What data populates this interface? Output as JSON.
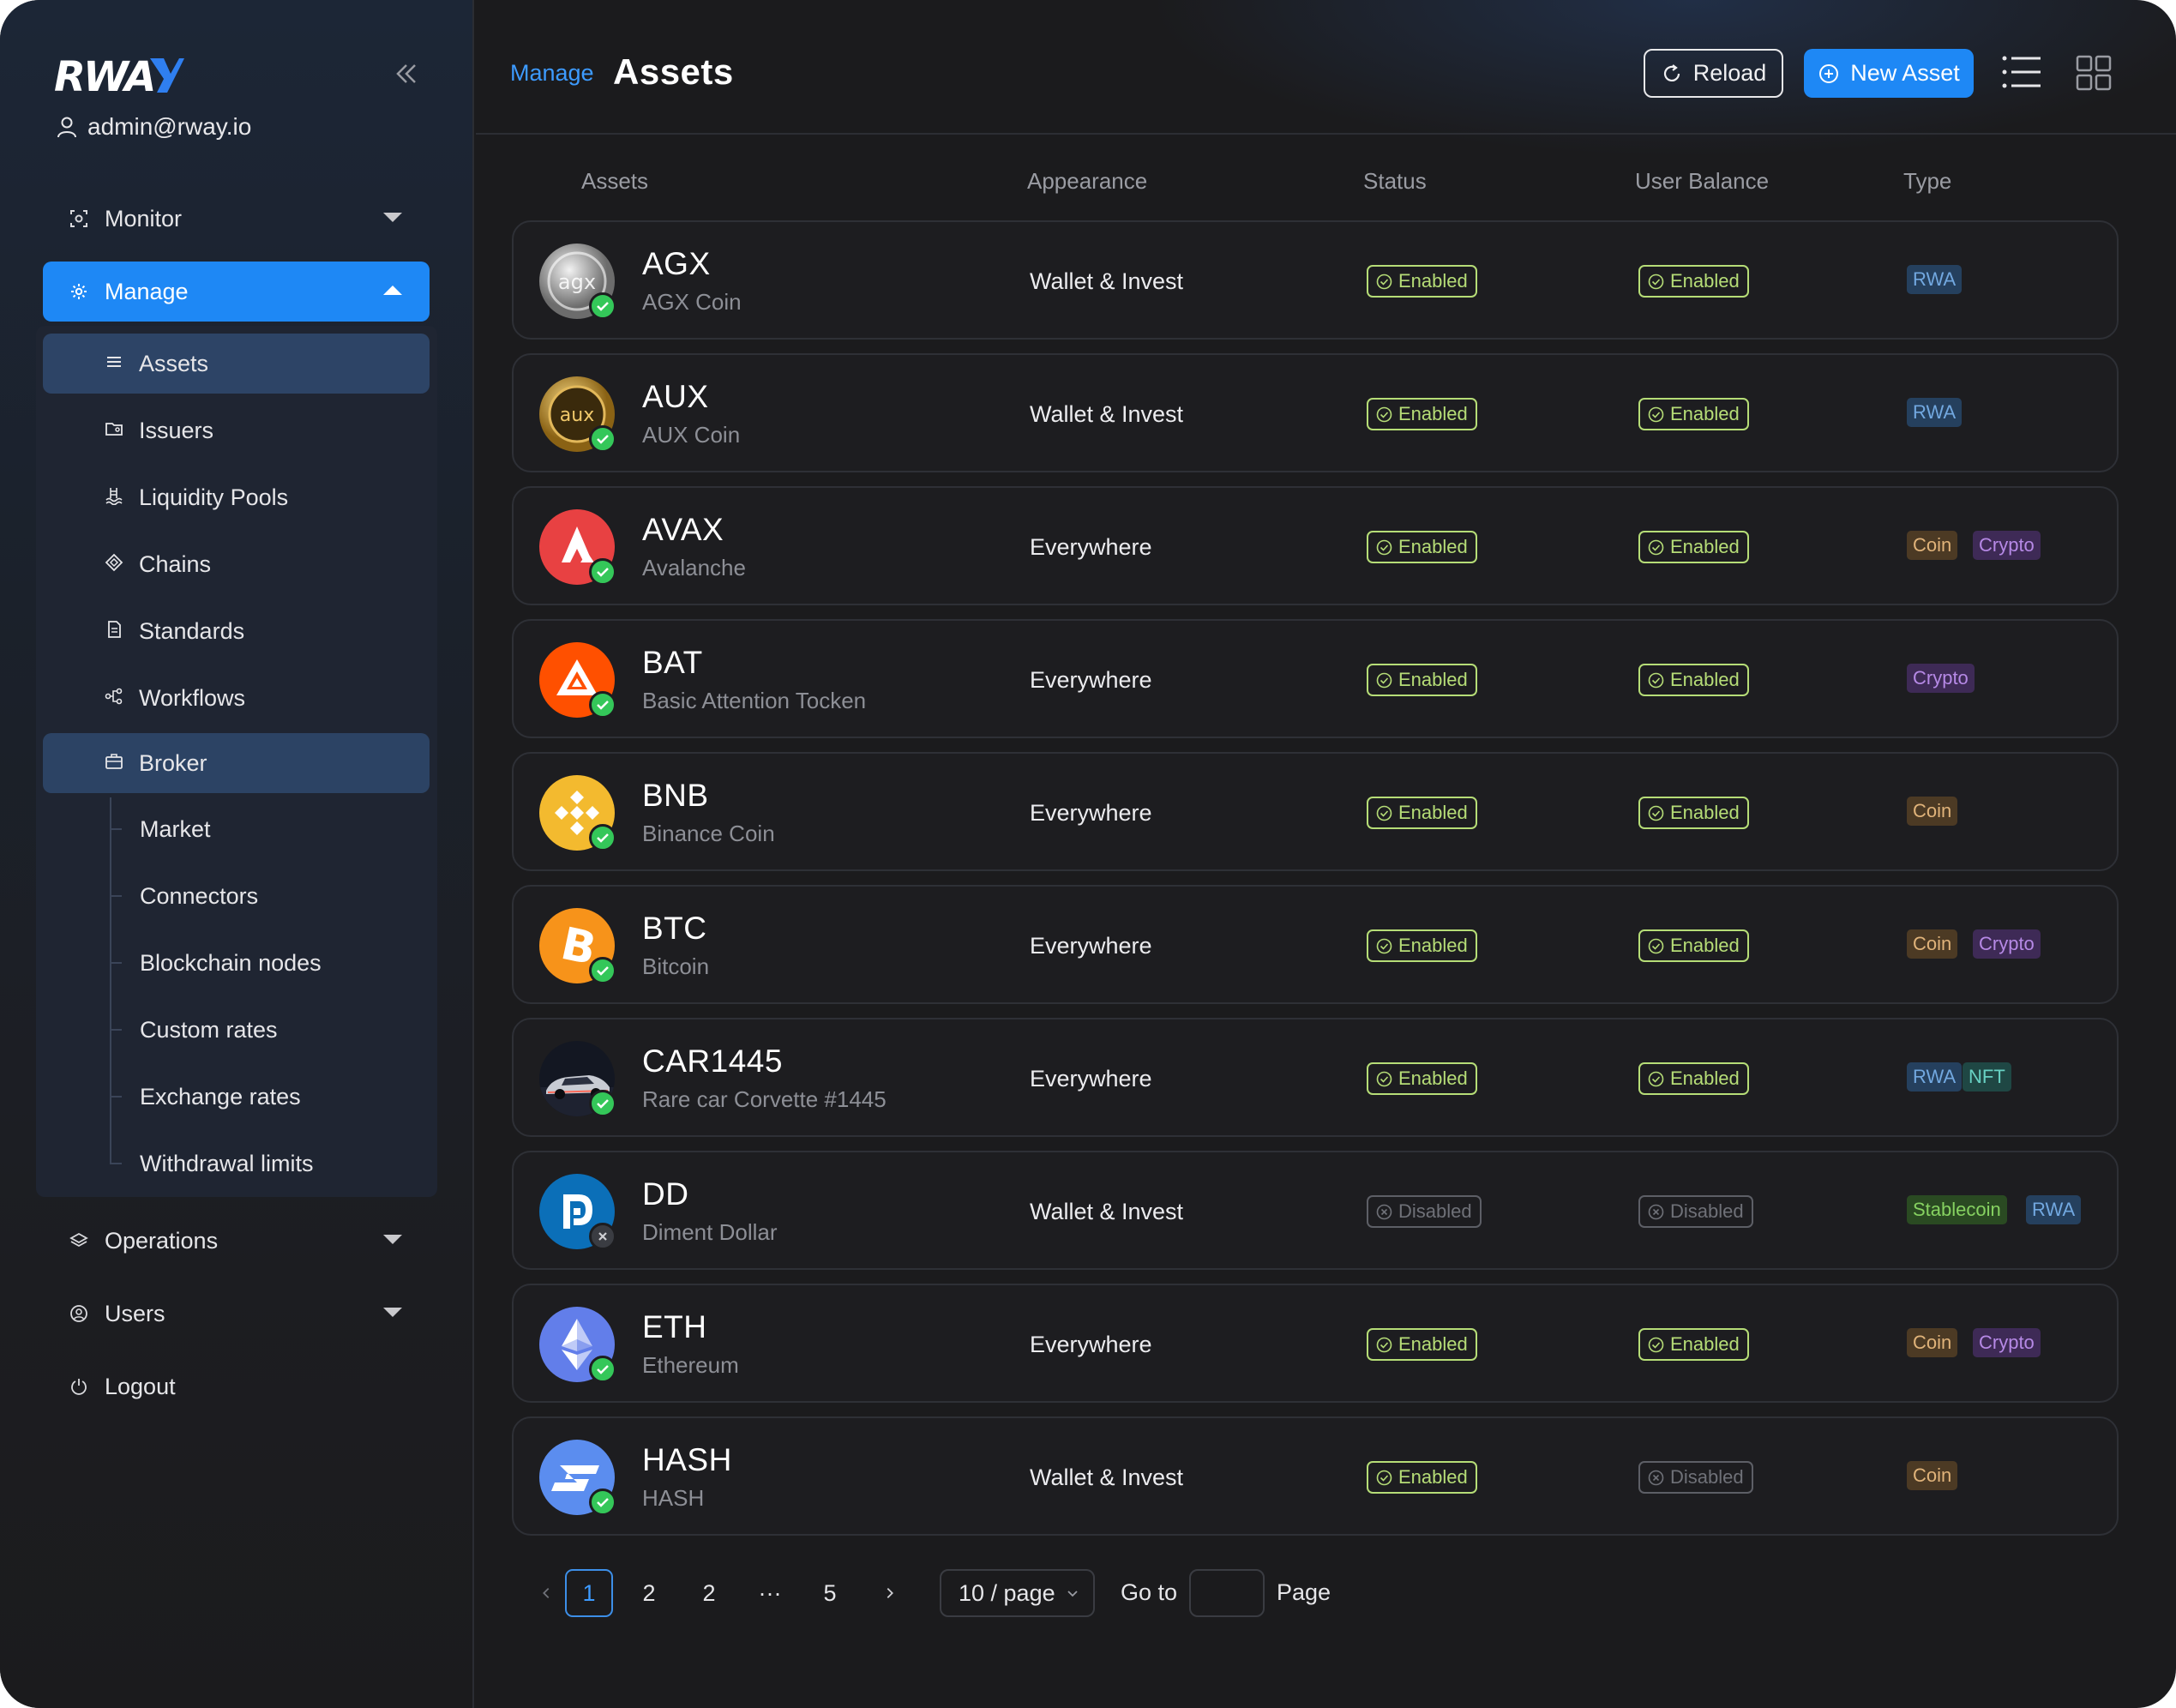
{
  "brand": {
    "logo_text": "RWAY",
    "accent": "#1e88f5"
  },
  "user": {
    "email": "admin@rway.io"
  },
  "nav": {
    "monitor": "Monitor",
    "manage": "Manage",
    "manage_items": {
      "assets": "Assets",
      "issuers": "Issuers",
      "liquidity_pools": "Liquidity Pools",
      "chains": "Chains",
      "standards": "Standards",
      "workflows": "Workflows",
      "broker": "Broker"
    },
    "broker_items": [
      "Market",
      "Connectors",
      "Blockchain nodes",
      "Custom rates",
      "Exchange rates",
      "Withdrawal limits"
    ],
    "operations": "Operations",
    "users": "Users",
    "logout": "Logout"
  },
  "header": {
    "breadcrumb": "Manage",
    "title": "Assets",
    "reload_label": "Reload",
    "new_asset_label": "New Asset"
  },
  "table": {
    "columns": {
      "assets": "Assets",
      "appearance": "Appearance",
      "status": "Status",
      "user_balance": "User Balance",
      "type": "Type"
    },
    "rows": [
      {
        "symbol": "AGX",
        "name": "AGX Coin",
        "appearance": "Wallet & Invest",
        "status": "Enabled",
        "user_balance": "Enabled",
        "types": [
          "RWA"
        ],
        "active": true
      },
      {
        "symbol": "AUX",
        "name": "AUX Coin",
        "appearance": "Wallet & Invest",
        "status": "Enabled",
        "user_balance": "Enabled",
        "types": [
          "RWA"
        ],
        "active": true
      },
      {
        "symbol": "AVAX",
        "name": "Avalanche",
        "appearance": "Everywhere",
        "status": "Enabled",
        "user_balance": "Enabled",
        "types": [
          "Coin",
          "Crypto"
        ],
        "active": true
      },
      {
        "symbol": "BAT",
        "name": "Basic Attention Tocken",
        "appearance": "Everywhere",
        "status": "Enabled",
        "user_balance": "Enabled",
        "types": [
          "Crypto"
        ],
        "active": true
      },
      {
        "symbol": "BNB",
        "name": "Binance Coin",
        "appearance": "Everywhere",
        "status": "Enabled",
        "user_balance": "Enabled",
        "types": [
          "Coin"
        ],
        "active": true
      },
      {
        "symbol": "BTC",
        "name": "Bitcoin",
        "appearance": "Everywhere",
        "status": "Enabled",
        "user_balance": "Enabled",
        "types": [
          "Coin",
          "Crypto"
        ],
        "active": true
      },
      {
        "symbol": "CAR1445",
        "name": "Rare car Corvette #1445",
        "appearance": "Everywhere",
        "status": "Enabled",
        "user_balance": "Enabled",
        "types": [
          "RWA",
          "NFT"
        ],
        "active": true
      },
      {
        "symbol": "DD",
        "name": "Diment Dollar",
        "appearance": "Wallet & Invest",
        "status": "Disabled",
        "user_balance": "Disabled",
        "types": [
          "Stablecoin",
          "RWA"
        ],
        "active": false
      },
      {
        "symbol": "ETH",
        "name": "Ethereum",
        "appearance": "Everywhere",
        "status": "Enabled",
        "user_balance": "Enabled",
        "types": [
          "Coin",
          "Crypto"
        ],
        "active": true
      },
      {
        "symbol": "HASH",
        "name": "HASH",
        "appearance": "Wallet & Invest",
        "status": "Enabled",
        "user_balance": "Disabled",
        "types": [
          "Coin"
        ],
        "active": true
      }
    ]
  },
  "pagination": {
    "pages": [
      "1",
      "2",
      "2",
      "···",
      "5"
    ],
    "current": "1",
    "per_page": "10 / page",
    "goto_label": "Go to",
    "goto_value": "",
    "page_label": "Page"
  }
}
